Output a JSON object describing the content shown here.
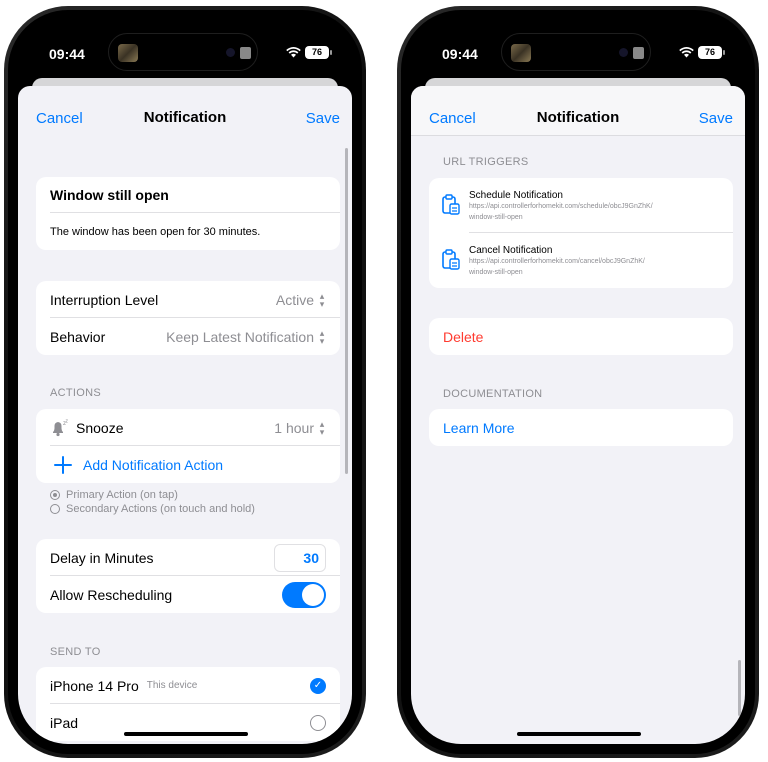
{
  "status": {
    "time": "09:44",
    "battery": "76"
  },
  "left": {
    "nav": {
      "cancel": "Cancel",
      "title": "Notification",
      "save": "Save"
    },
    "notification": {
      "title": "Window still open",
      "body": "The window has been open for 30 minutes."
    },
    "settings": [
      {
        "label": "Interruption Level",
        "value": "Active"
      },
      {
        "label": "Behavior",
        "value": "Keep Latest Notification"
      }
    ],
    "actions_header": "ACTIONS",
    "action_item": {
      "label": "Snooze",
      "value": "1 hour"
    },
    "add_action": "Add Notification Action",
    "legend": {
      "primary": "Primary Action (on tap)",
      "secondary": "Secondary Actions (on touch and hold)"
    },
    "delay": {
      "label": "Delay in Minutes",
      "value": "30"
    },
    "rescheduling": {
      "label": "Allow Rescheduling",
      "enabled": true
    },
    "send_to_header": "SEND TO",
    "devices": [
      {
        "name": "iPhone 14 Pro",
        "note": "This device",
        "selected": true
      },
      {
        "name": "iPad",
        "note": "",
        "selected": false
      }
    ]
  },
  "right": {
    "nav": {
      "cancel": "Cancel",
      "title": "Notification",
      "save": "Save"
    },
    "url_triggers_header": "URL TRIGGERS",
    "triggers": [
      {
        "title": "Schedule Notification",
        "url1": "https://api.controllerforhomekit.com/schedule/obcJ9GnZhK/",
        "url2": "window-still-open"
      },
      {
        "title": "Cancel Notification",
        "url1": "https://api.controllerforhomekit.com/cancel/obcJ9GnZhK/",
        "url2": "window-still-open"
      }
    ],
    "delete": "Delete",
    "documentation_header": "DOCUMENTATION",
    "learn_more": "Learn More"
  },
  "colors": {
    "accent": "#007aff",
    "destructive": "#ff3b30",
    "background": "#f2f2f7"
  },
  "icons": [
    "wifi-icon",
    "battery-icon",
    "snooze-bell-icon",
    "plus-icon",
    "checkmark-icon",
    "clipboard-link-icon"
  ]
}
